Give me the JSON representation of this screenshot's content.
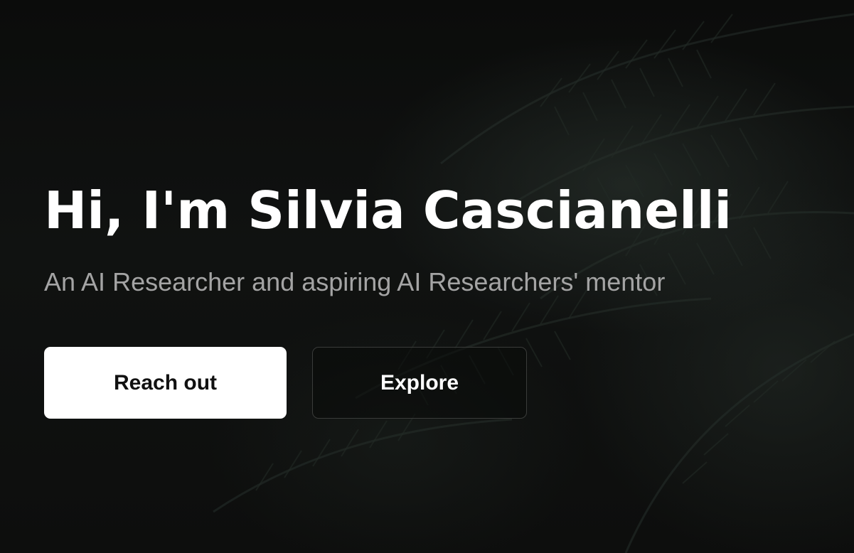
{
  "hero": {
    "headline": "Hi, I'm Silvia Cascianelli",
    "subtitle": "An AI Researcher and aspiring AI Researchers' mentor"
  },
  "actions": {
    "primary_label": "Reach out",
    "secondary_label": "Explore"
  },
  "colors": {
    "background": "#0c0d0c",
    "primary_button_bg": "#ffffff",
    "primary_button_text": "#111111",
    "secondary_button_border": "#3a3c3a",
    "subtitle_text": "#a4a4a4"
  }
}
